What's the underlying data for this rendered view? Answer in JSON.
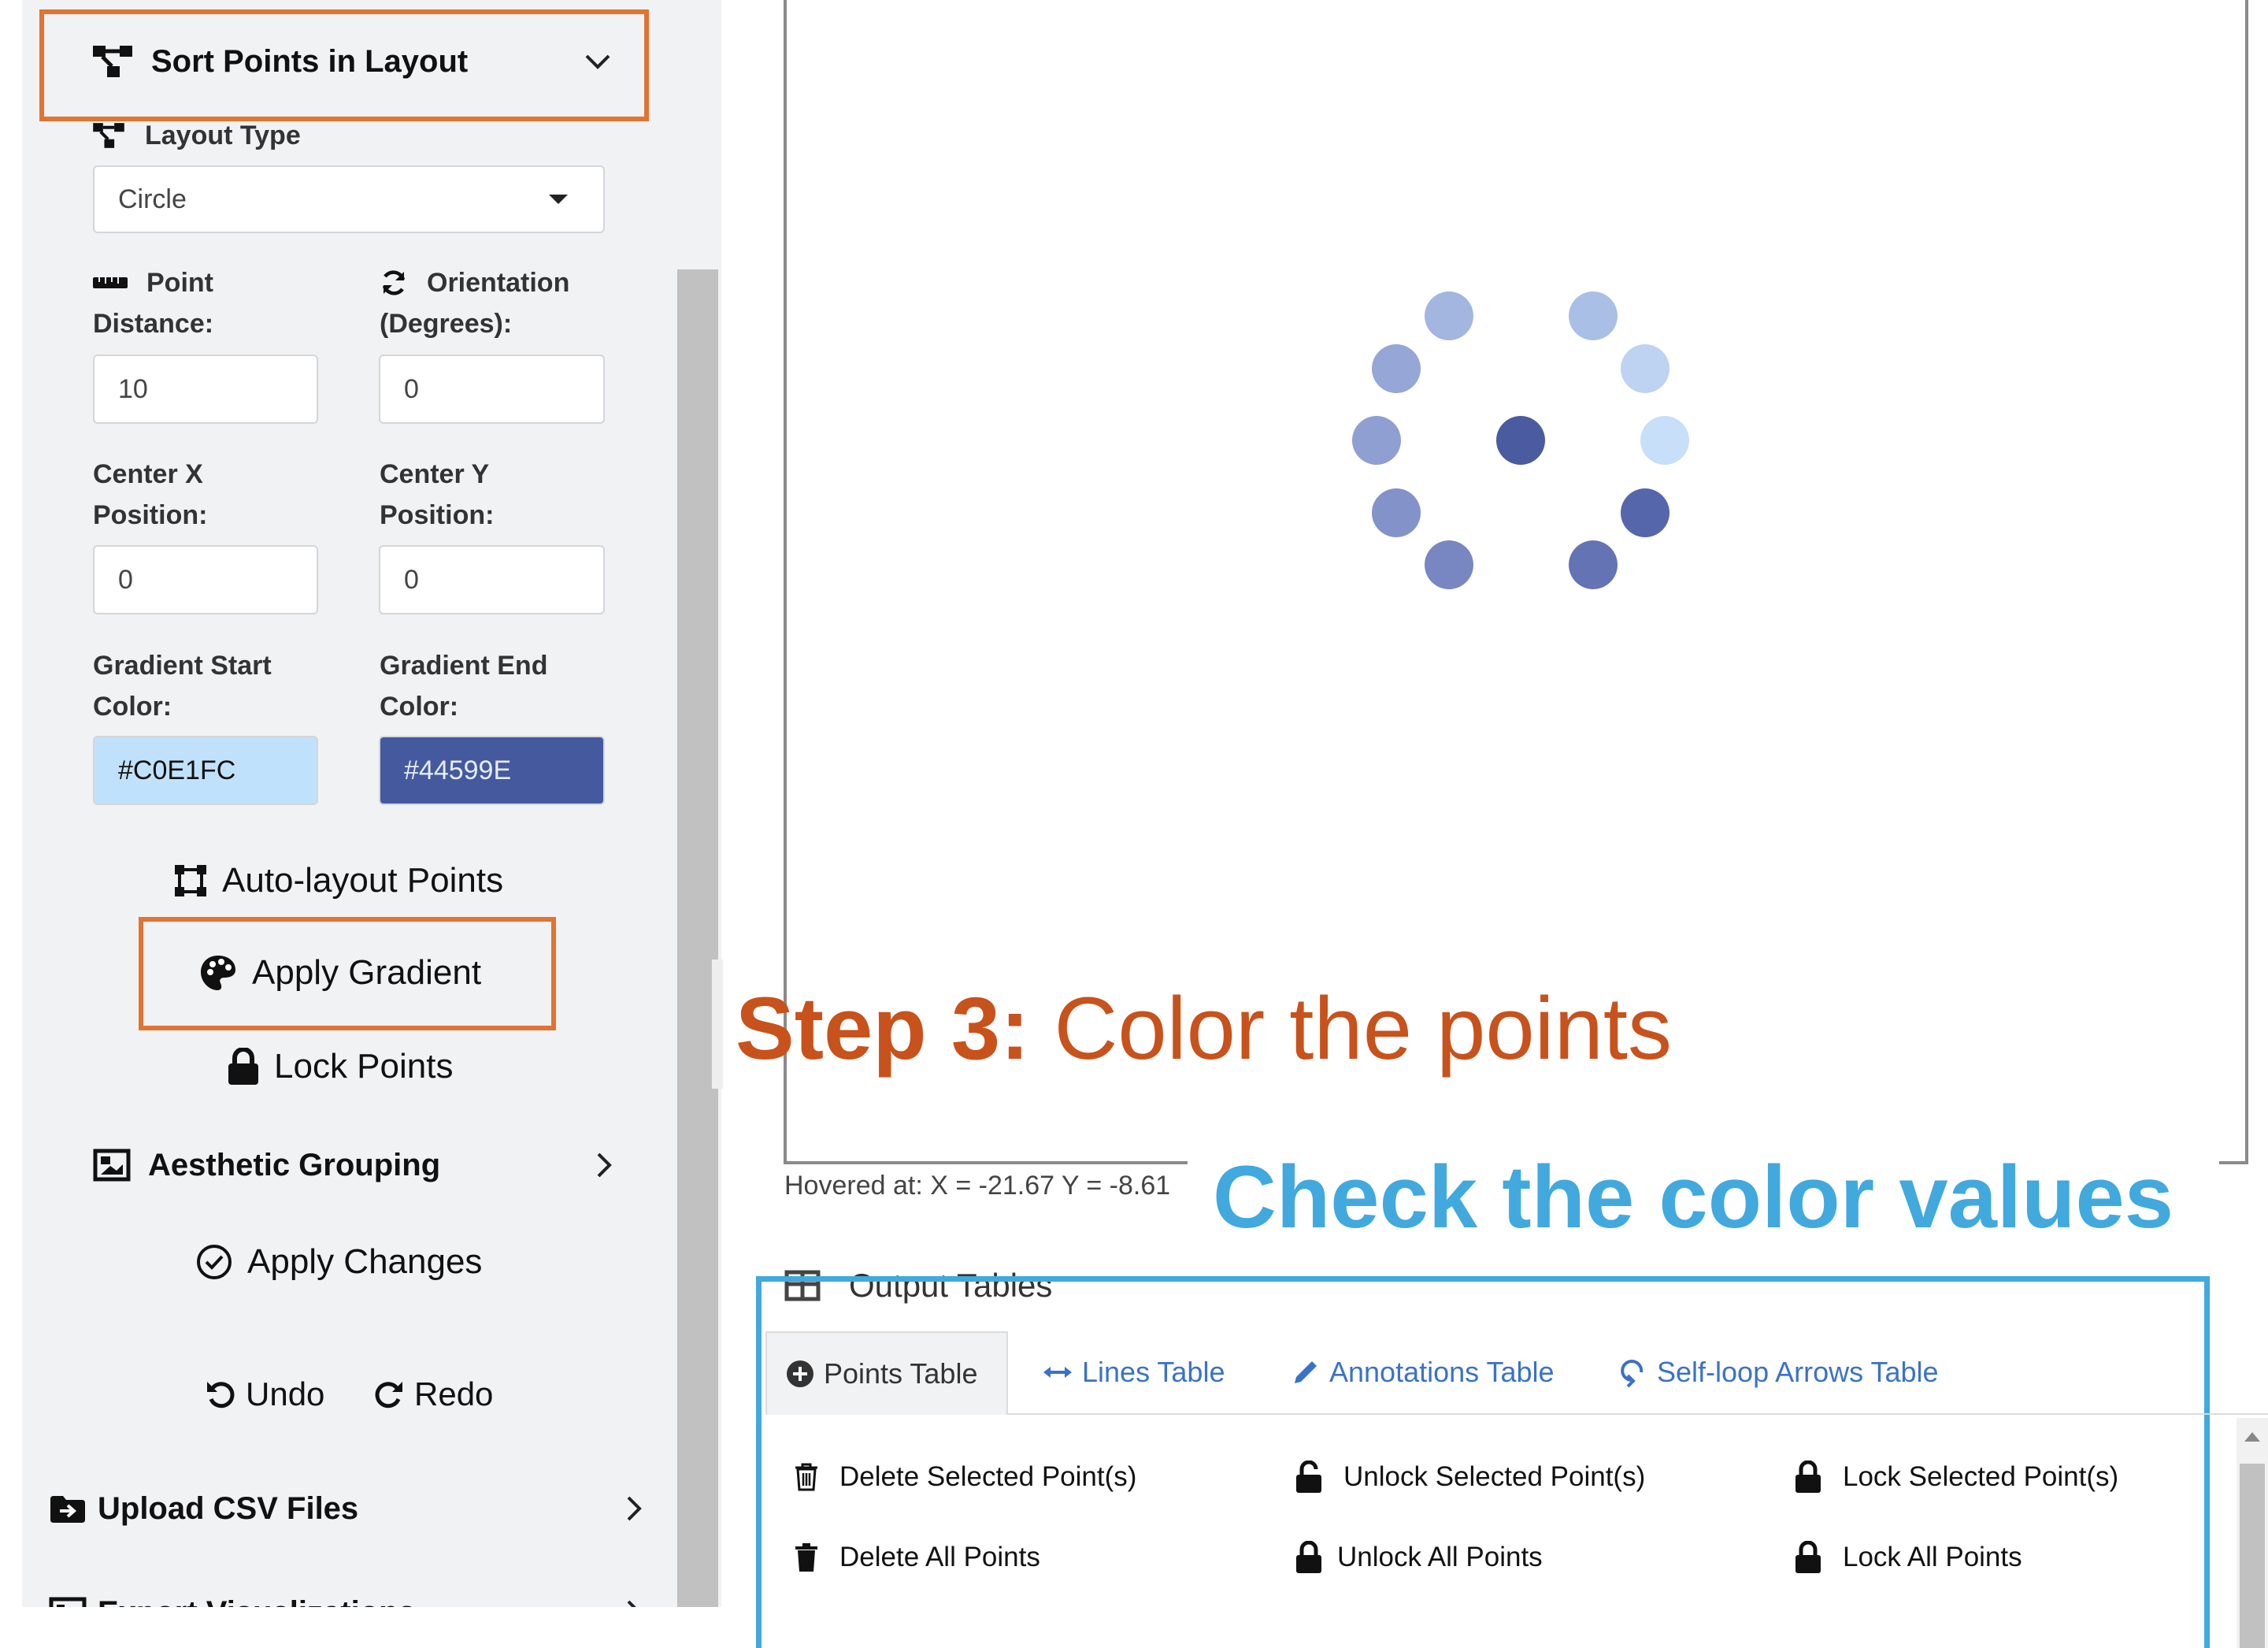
{
  "sidebar": {
    "section_title": "Sort Points in Layout",
    "layout_type_label": "Layout Type",
    "layout_type_value": "Circle",
    "point_distance_label_1": "Point",
    "point_distance_label_2": "Distance:",
    "point_distance_value": "10",
    "orientation_label_1": "Orientation",
    "orientation_label_2": "(Degrees):",
    "orientation_value": "0",
    "center_x_label_1": "Center X",
    "center_x_label_2": "Position:",
    "center_x_value": "0",
    "center_y_label_1": "Center Y",
    "center_y_label_2": "Position:",
    "center_y_value": "0",
    "gradient_start_label_1": "Gradient Start",
    "gradient_start_label_2": "Color:",
    "gradient_start_value": "#C0E1FC",
    "gradient_end_label_1": "Gradient End",
    "gradient_end_label_2": "Color:",
    "gradient_end_value": "#44599E",
    "auto_layout_label": "Auto-layout Points",
    "apply_gradient_label": "Apply Gradient",
    "lock_points_label": "Lock Points",
    "aesthetic_grouping_label": "Aesthetic Grouping",
    "apply_changes_label": "Apply Changes",
    "undo_label": "Undo",
    "redo_label": "Redo",
    "upload_csv_label": "Upload CSV Files",
    "export_label": "Export Visualizations"
  },
  "plot": {
    "hovered_text": "Hovered at: X = -21.67 Y = -8.61",
    "points": [
      {
        "color": "#4a5ba0"
      },
      {
        "color": "#c7dff8"
      },
      {
        "color": "#bdd3f1"
      },
      {
        "color": "#aabfe6"
      },
      {
        "color": "#a3b6e0"
      },
      {
        "color": "#96a6d7"
      },
      {
        "color": "#8f9fd1"
      },
      {
        "color": "#8492ca"
      },
      {
        "color": "#7886c1"
      },
      {
        "color": "#6473b3"
      },
      {
        "color": "#5666aa"
      }
    ]
  },
  "annotations": {
    "step3_bold": "Step 3:",
    "step3_text": "Color the points",
    "check_text": "Check the color values",
    "orange_color": "#c8521c",
    "blue_color": "#41a9dd"
  },
  "tables": {
    "heading": "Output Tables",
    "tabs": [
      {
        "label": "Points Table"
      },
      {
        "label": "Lines Table"
      },
      {
        "label": "Annotations Table"
      },
      {
        "label": "Self-loop Arrows Table"
      }
    ],
    "actions": {
      "delete_selected": "Delete Selected Point(s)",
      "unlock_selected": "Unlock Selected Point(s)",
      "lock_selected": "Lock Selected Point(s)",
      "delete_all": "Delete All Points",
      "unlock_all": "Unlock All Points",
      "lock_all": "Lock All Points"
    }
  },
  "icons": {
    "section": "network-icon",
    "distance": "ruler-icon",
    "orientation": "rotate-icon",
    "auto_layout": "vector-square-icon",
    "gradient": "palette-icon",
    "lock": "lock-icon",
    "grouping": "image-icon",
    "apply": "check-circle-icon",
    "undo": "undo-icon",
    "redo": "redo-icon",
    "upload": "file-import-icon"
  }
}
